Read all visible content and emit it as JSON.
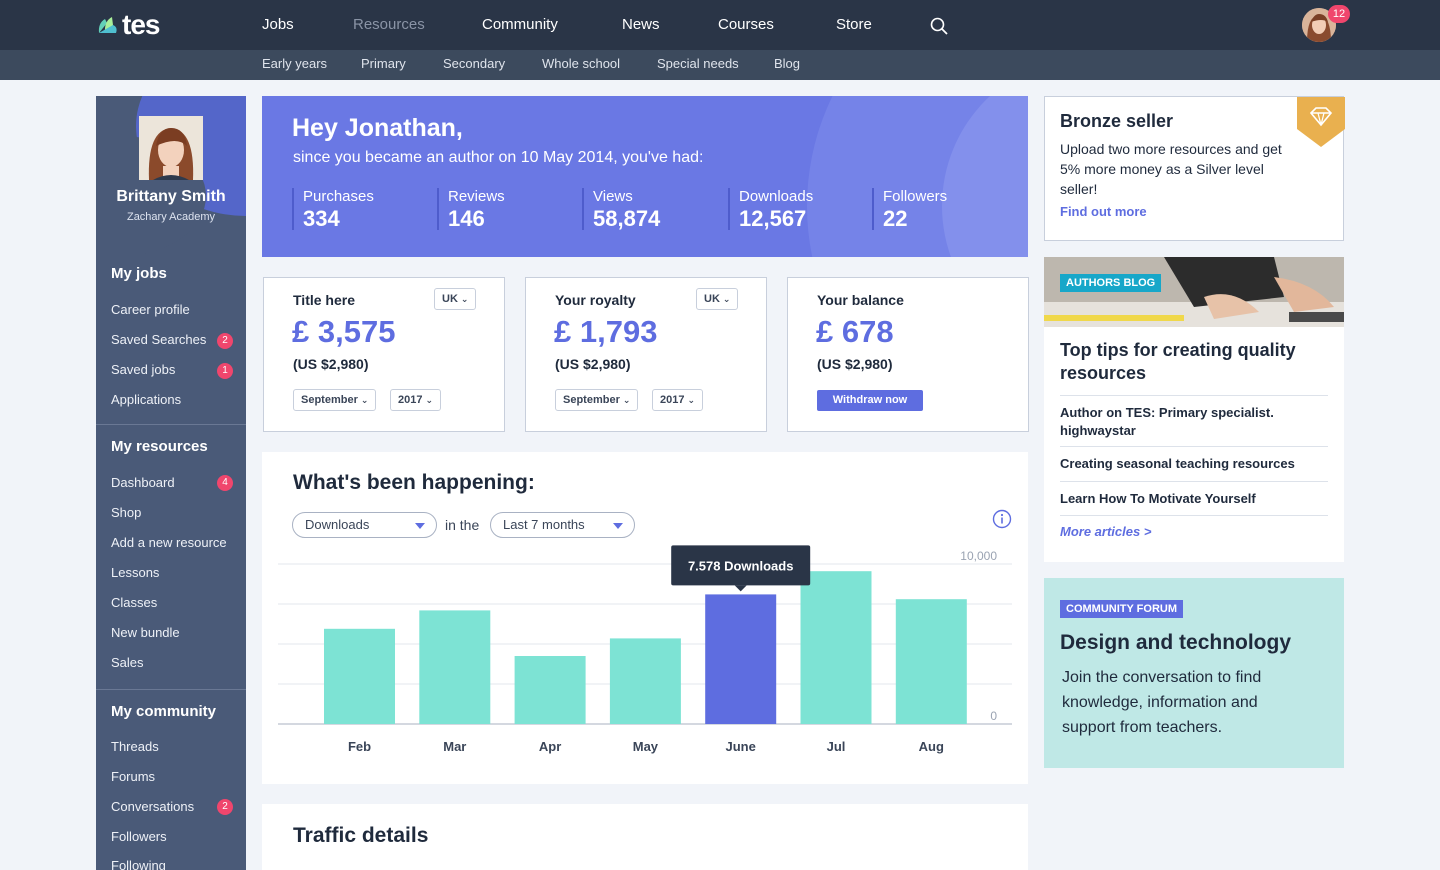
{
  "brand": {
    "name": "tes"
  },
  "nav": {
    "items": [
      {
        "label": "Jobs"
      },
      {
        "label": "Resources"
      },
      {
        "label": "Community"
      },
      {
        "label": "News"
      },
      {
        "label": "Courses"
      },
      {
        "label": "Store"
      }
    ],
    "notification_count": "12",
    "active_item": "Resources"
  },
  "subnav": {
    "items": [
      {
        "label": "Early years"
      },
      {
        "label": "Primary"
      },
      {
        "label": "Secondary"
      },
      {
        "label": "Whole school"
      },
      {
        "label": "Special needs"
      },
      {
        "label": "Blog"
      }
    ]
  },
  "profile": {
    "name": "Brittany Smith",
    "school": "Zachary Academy"
  },
  "sidebar": {
    "sections": [
      {
        "title": "My jobs",
        "links": [
          {
            "label": "Career profile"
          },
          {
            "label": "Saved Searches",
            "badge": "2"
          },
          {
            "label": "Saved jobs",
            "badge": "1"
          },
          {
            "label": "Applications"
          }
        ]
      },
      {
        "title": "My resources",
        "links": [
          {
            "label": "Dashboard",
            "badge": "4"
          },
          {
            "label": "Shop"
          },
          {
            "label": "Add a new resource"
          },
          {
            "label": "Lessons"
          },
          {
            "label": "Classes"
          },
          {
            "label": "New bundle"
          },
          {
            "label": "Sales"
          }
        ]
      },
      {
        "title": "My community",
        "links": [
          {
            "label": "Threads"
          },
          {
            "label": "Forums"
          },
          {
            "label": "Conversations",
            "badge": "2"
          },
          {
            "label": "Followers"
          },
          {
            "label": "Following"
          }
        ]
      }
    ]
  },
  "hero": {
    "greeting": "Hey Jonathan,",
    "subtitle": "since you became an author on 10 May 2014, you've had:",
    "stats": [
      {
        "label": "Purchases",
        "value": "334"
      },
      {
        "label": "Reviews",
        "value": "146"
      },
      {
        "label": "Views",
        "value": "58,874"
      },
      {
        "label": "Downloads",
        "value": "12,567"
      },
      {
        "label": "Followers",
        "value": "22"
      }
    ]
  },
  "cards": {
    "title": {
      "heading": "Title here",
      "region": "UK",
      "amount": "£ 3,575",
      "usd": "(US $2,980)",
      "month": "September",
      "year": "2017"
    },
    "royalty": {
      "heading": "Your royalty",
      "region": "UK",
      "amount": "£ 1,793",
      "usd": "(US $2,980)",
      "month": "September",
      "year": "2017"
    },
    "balance": {
      "heading": "Your balance",
      "amount": "£ 678",
      "usd": "(US $2,980)",
      "button": "Withdraw now"
    }
  },
  "activity": {
    "title": "What's been happening:",
    "metric": "Downloads",
    "connector": "in the",
    "period": "Last 7 months",
    "tooltip": "7.578 Downloads"
  },
  "chart_data": {
    "type": "bar",
    "categories": [
      "Feb",
      "Mar",
      "Apr",
      "May",
      "June",
      "Jul",
      "Aug"
    ],
    "values": [
      5950,
      7100,
      4250,
      5350,
      8100,
      9550,
      7800
    ],
    "highlight_index": 4,
    "ylim": [
      0,
      10000
    ],
    "ytick_labels": [
      "10,000",
      "0"
    ],
    "colors": {
      "bar": "#7de3d4",
      "highlight": "#5e6de0"
    },
    "grid": true,
    "title": "",
    "xlabel": "",
    "ylabel": ""
  },
  "traffic": {
    "title": "Traffic details"
  },
  "bronze": {
    "title": "Bronze seller",
    "body": "Upload two more resources and get 5% more money as a Silver level seller!",
    "link": "Find out more"
  },
  "blog": {
    "tag": "AUTHORS BLOG",
    "title": "Top tips for creating quality resources",
    "items": [
      {
        "label": "Author on TES: Primary specialist. highwaystar"
      },
      {
        "label": "Creating seasonal teaching resources"
      },
      {
        "label": "Learn How To Motivate Yourself"
      }
    ],
    "more": "More articles >"
  },
  "forum": {
    "tag": "COMMUNITY FORUM",
    "title": "Design and technology",
    "body": "Join the conversation to find knowledge, information and support from teachers."
  },
  "colors": {
    "nav": "#2a3547",
    "accent": "#5e6de0",
    "badge": "#f0466d",
    "teal": "#7de3d4"
  }
}
